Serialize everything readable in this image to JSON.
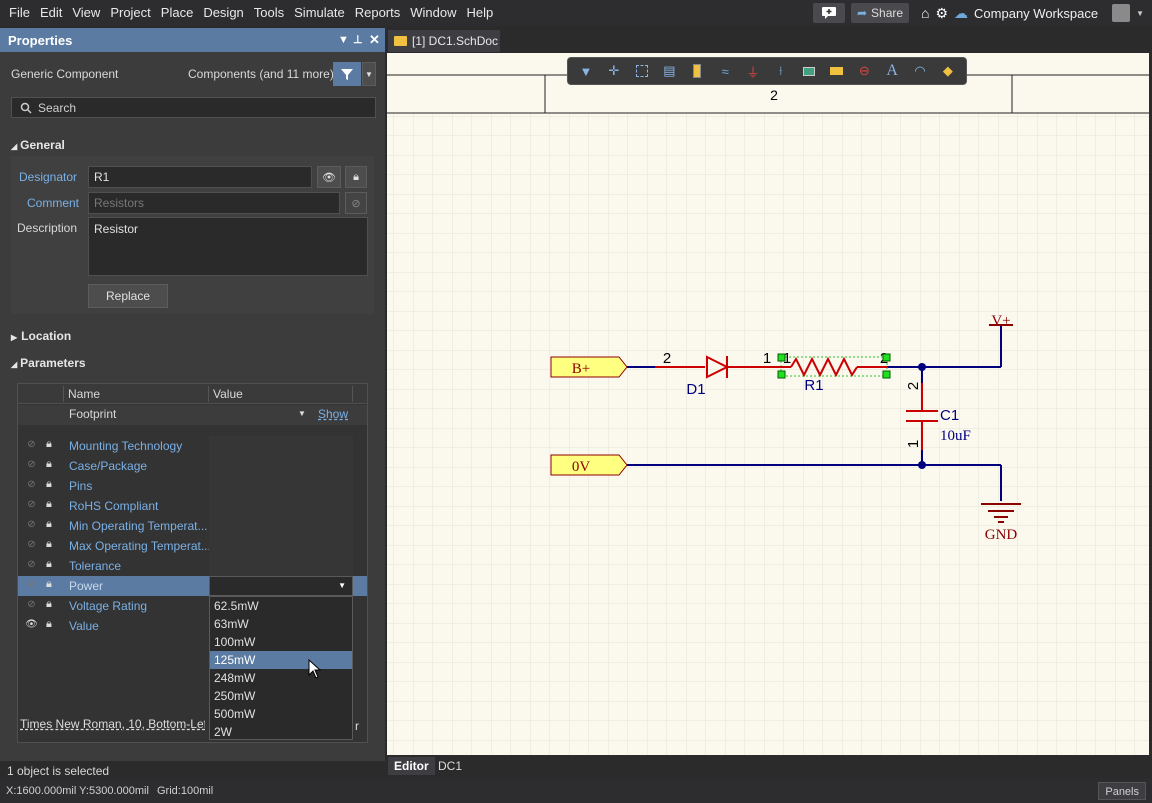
{
  "menu": {
    "items": [
      "File",
      "Edit",
      "View",
      "Project",
      "Place",
      "Design",
      "Tools",
      "Simulate",
      "Reports",
      "Window",
      "Help"
    ],
    "share": "Share",
    "workspace": "Company Workspace"
  },
  "panel": {
    "title": "Properties",
    "kind": "Generic Component",
    "filter_text": "Components (and 11 more)",
    "search_placeholder": "Search",
    "general": {
      "section": "General",
      "designator_label": "Designator",
      "designator": "R1",
      "comment_label": "Comment",
      "comment_placeholder": "Resistors",
      "description_label": "Description",
      "description": "Resistor",
      "replace": "Replace"
    },
    "location_section": "Location",
    "parameters_section": "Parameters",
    "table": {
      "col_name": "Name",
      "col_value": "Value",
      "footprint": "Footprint",
      "show": "Show",
      "params": [
        "Mounting Technology",
        "Case/Package",
        "Pins",
        "RoHS Compliant",
        "Min Operating Temperat...",
        "Max Operating Temperat...",
        "Tolerance",
        "Power",
        "Voltage Rating",
        "Value"
      ],
      "font_info": "Times New Roman, 10, Bottom-Left"
    },
    "dropdown": {
      "options": [
        "62.5mW",
        "63mW",
        "100mW",
        "125mW",
        "248mW",
        "250mW",
        "500mW",
        "2W"
      ],
      "selected": "125mW"
    }
  },
  "editor": {
    "tab": "[1] DC1.SchDoc *",
    "sheet_zone": "2",
    "bottom_tabs": [
      "Editor",
      "DC1"
    ],
    "schematic": {
      "port_b": "B+",
      "port_0v": "0V",
      "d1": "D1",
      "r1": "R1",
      "c1": "C1",
      "c1_value": "10uF",
      "vplus": "V+",
      "gnd": "GND",
      "pin1": "1",
      "pin2": "2"
    }
  },
  "status": {
    "selection": "1 object is selected",
    "coords": "X:1600.000mil Y:5300.000mil",
    "grid": "Grid:100mil",
    "panels": "Panels"
  },
  "colors": {
    "accent": "#5b7ba3",
    "wire": "#00007f",
    "part": "#cc0000",
    "power": "#8b0000",
    "port_fill": "#ffff80"
  }
}
